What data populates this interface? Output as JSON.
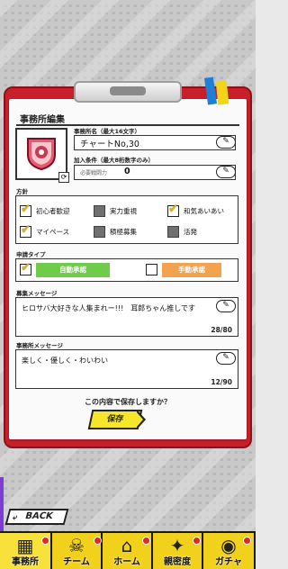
{
  "header": {
    "title": "事務所編集"
  },
  "office_name": {
    "label": "事務所名（最大16文字）",
    "value": "チャートNo,30"
  },
  "join_condition": {
    "label": "加入条件（最大8桁数字のみ）",
    "sublabel": "必要戦闘力",
    "value": "0"
  },
  "policy": {
    "label": "方針",
    "options": [
      {
        "label": "初心者歓迎",
        "checked": true
      },
      {
        "label": "実力重視",
        "checked": false
      },
      {
        "label": "和気あいあい",
        "checked": true
      },
      {
        "label": "マイペース",
        "checked": true
      },
      {
        "label": "積極募集",
        "checked": false
      },
      {
        "label": "活発",
        "checked": false
      }
    ]
  },
  "application": {
    "label": "申請タイプ",
    "auto": "自動承認",
    "manual": "手動承認",
    "auto_checked": true
  },
  "recruit_message": {
    "label": "募集メッセージ",
    "value": "ヒロサバ大好きな人集まれー!!!　耳郎ちゃん推しです",
    "counter": "28/80"
  },
  "office_message": {
    "label": "事務所メッセージ",
    "value": "楽しく・優しく・わいわい",
    "counter": "12/90"
  },
  "confirm_text": "この内容で保存しますか？",
  "save_label": "保存",
  "back_label": "BACK",
  "tabs": [
    {
      "label": "事務所",
      "icon": "office-icon"
    },
    {
      "label": "チーム",
      "icon": "team-icon"
    },
    {
      "label": "ホーム",
      "icon": "home-icon"
    },
    {
      "label": "親密度",
      "icon": "intimacy-icon"
    },
    {
      "label": "ガチャ",
      "icon": "gacha-icon"
    }
  ],
  "colors": {
    "board": "#c8202a",
    "accent": "#f2d11c",
    "auto": "#6fcb4a",
    "manual": "#f3a24f"
  }
}
